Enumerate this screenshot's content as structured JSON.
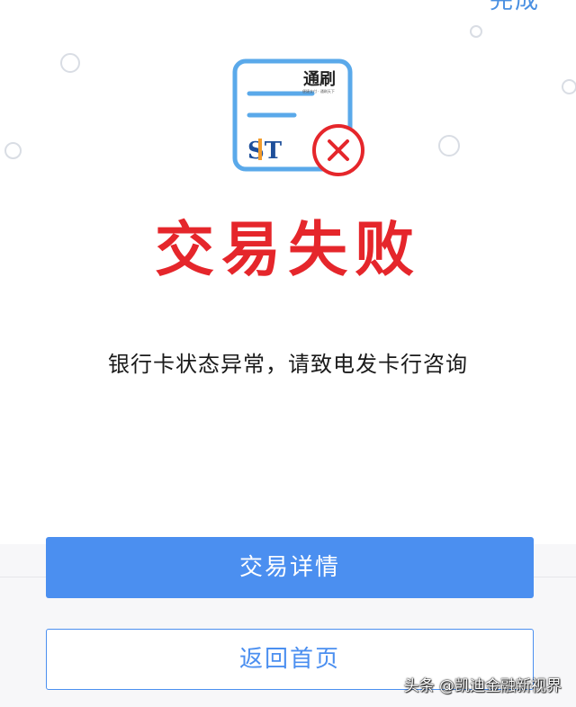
{
  "header": {
    "done_label": "完成"
  },
  "illustration": {
    "logo_text": "通刷",
    "logo_slogan": "便捷支付 · 通刷天下",
    "brand_mark": "ST",
    "status_icon": "close-x-icon",
    "colors": {
      "card_border": "#5aa9ea",
      "error": "#e5262b"
    }
  },
  "result": {
    "title": "交易失败",
    "message": "银行卡状态异常，请致电发卡行咨询"
  },
  "actions": {
    "details_label": "交易详情",
    "home_label": "返回首页"
  },
  "watermark": {
    "text": "头条 @凯迪金融新视界"
  },
  "colors": {
    "primary": "#4b8ff0",
    "error": "#e5262b"
  }
}
